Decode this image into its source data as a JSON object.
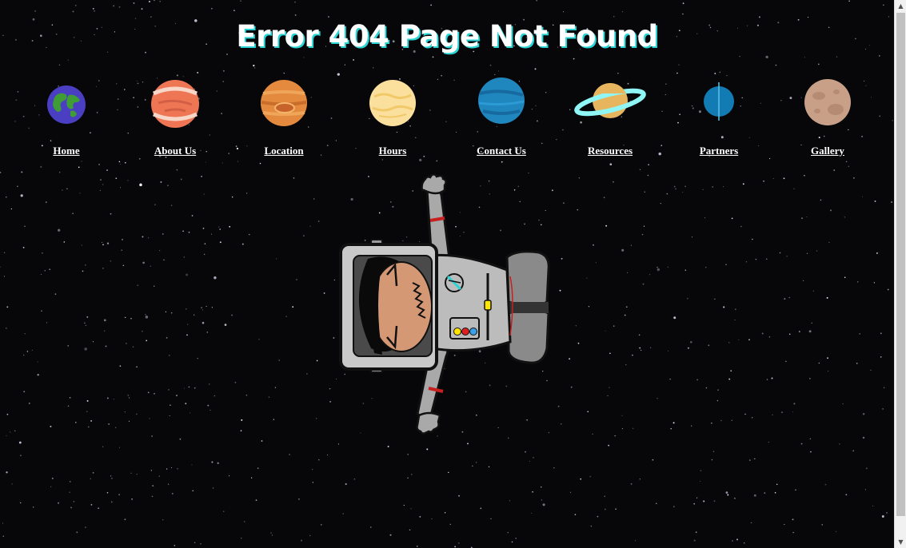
{
  "page": {
    "title": "Error 404 Page Not Found"
  },
  "nav": {
    "items": [
      {
        "label": "Home",
        "planet": "earth-icon"
      },
      {
        "label": "About Us",
        "planet": "mars-icon"
      },
      {
        "label": "Location",
        "planet": "jupiter-icon"
      },
      {
        "label": "Hours",
        "planet": "venus-icon"
      },
      {
        "label": "Contact Us",
        "planet": "neptune-icon"
      },
      {
        "label": "Resources",
        "planet": "saturn-icon"
      },
      {
        "label": "Partners",
        "planet": "uranus-icon"
      },
      {
        "label": "Gallery",
        "planet": "pluto-icon"
      }
    ]
  },
  "illustration": {
    "name": "astronaut-illustration"
  },
  "colors": {
    "background": "#07070a",
    "title_shadow": "#2ad4d4",
    "nav_text": "#ffffff"
  }
}
